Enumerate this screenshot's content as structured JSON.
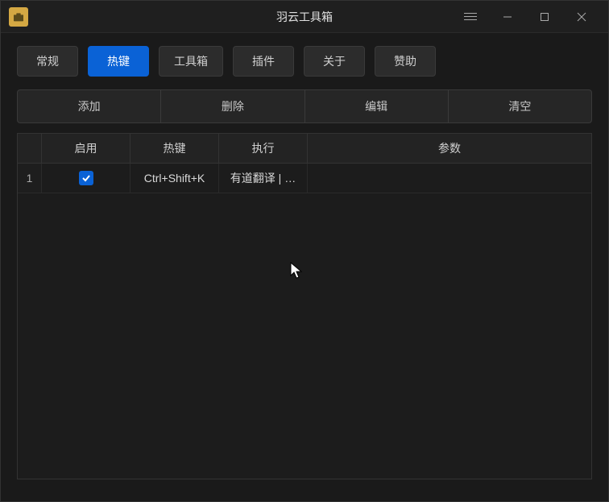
{
  "app": {
    "title": "羽云工具箱"
  },
  "tabs": [
    {
      "id": "general",
      "label": "常规",
      "active": false
    },
    {
      "id": "hotkey",
      "label": "热键",
      "active": true
    },
    {
      "id": "toolbox",
      "label": "工具箱",
      "active": false
    },
    {
      "id": "plugin",
      "label": "插件",
      "active": false
    },
    {
      "id": "about",
      "label": "关于",
      "active": false
    },
    {
      "id": "sponsor",
      "label": "赞助",
      "active": false
    }
  ],
  "actions": {
    "add": "添加",
    "delete": "删除",
    "edit": "编辑",
    "clear": "清空"
  },
  "table": {
    "headers": {
      "index": "",
      "enable": "启用",
      "hotkey": "热键",
      "exec": "执行",
      "params": "参数"
    },
    "rows": [
      {
        "index": "1",
        "enabled": true,
        "hotkey": "Ctrl+Shift+K",
        "exec": "有道翻译 | …",
        "params": ""
      }
    ]
  }
}
